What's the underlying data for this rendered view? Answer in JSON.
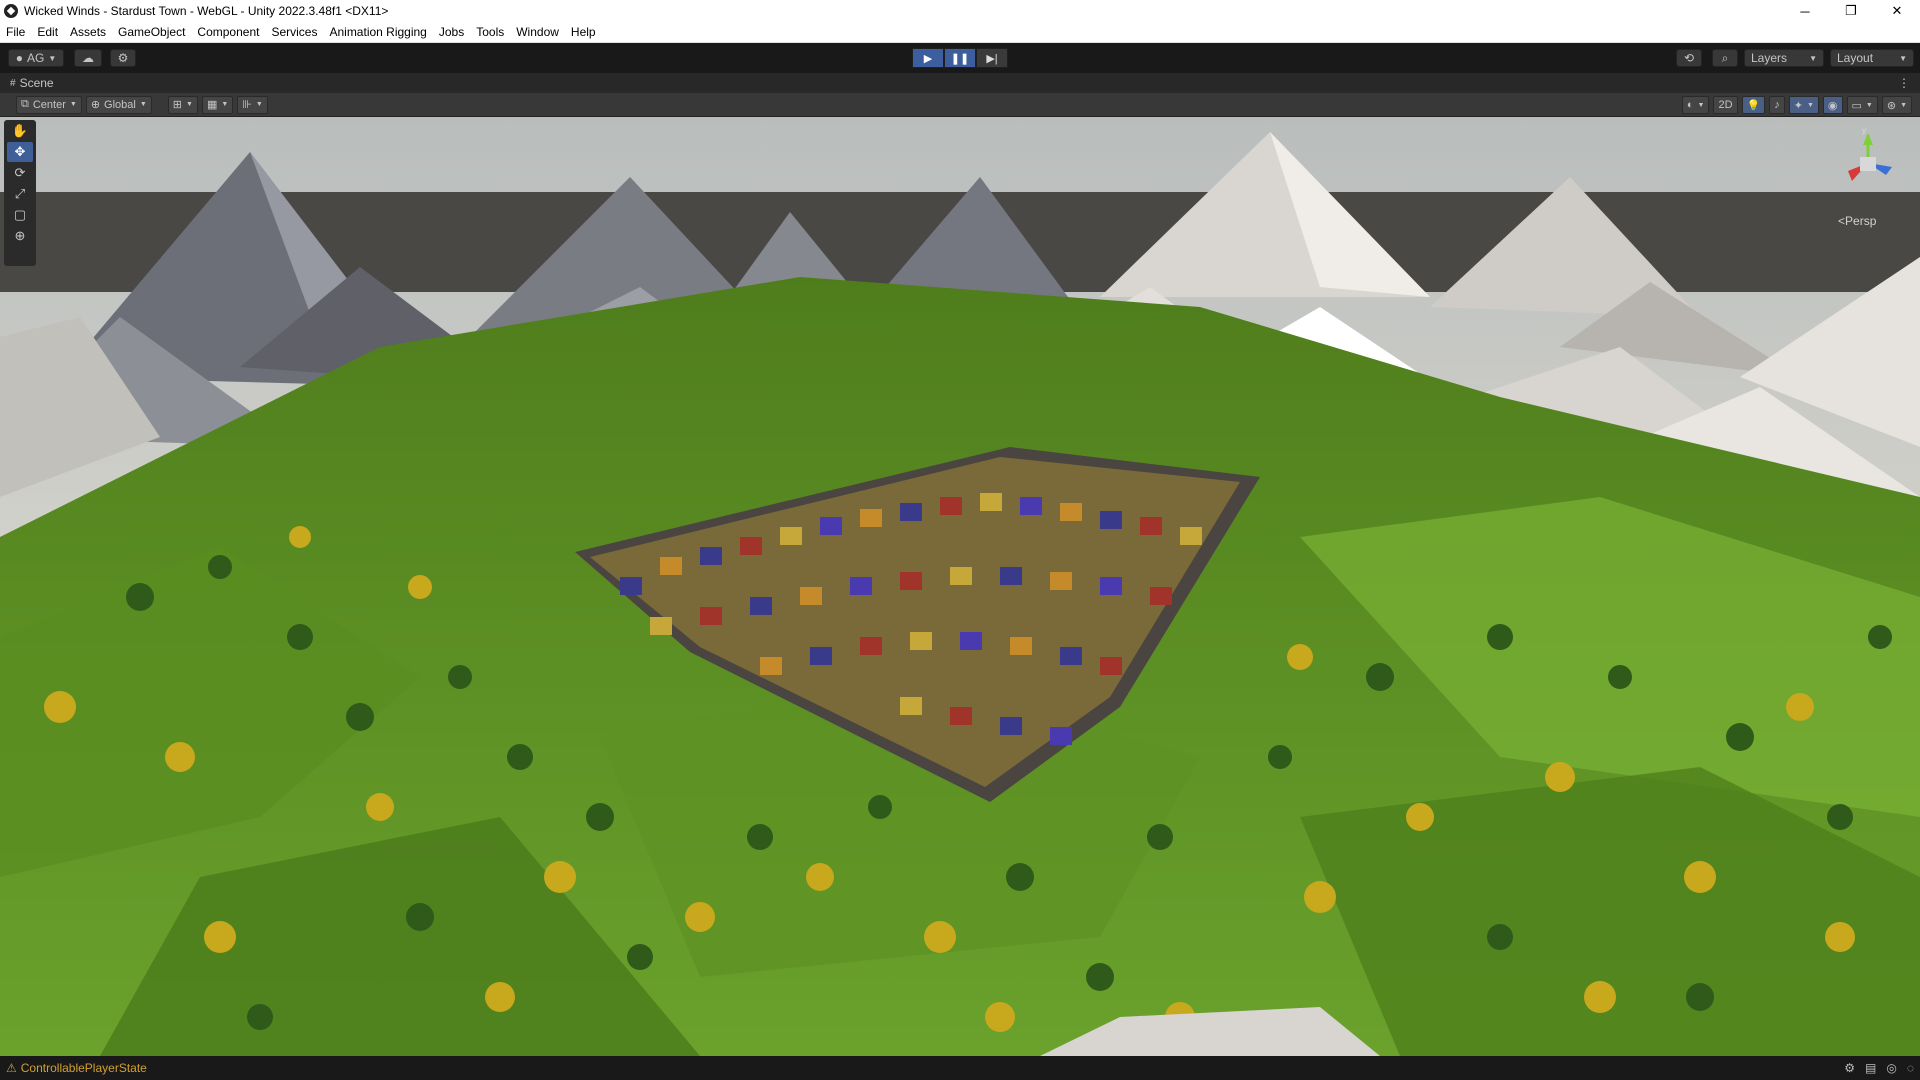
{
  "window": {
    "title": "Wicked Winds - Stardust Town - WebGL - Unity 2022.3.48f1 <DX11>",
    "controls": {
      "minimize": "─",
      "maximize": "❐",
      "close": "✕"
    }
  },
  "menu": [
    "File",
    "Edit",
    "Assets",
    "GameObject",
    "Component",
    "Services",
    "Animation Rigging",
    "Jobs",
    "Tools",
    "Window",
    "Help"
  ],
  "toolbar": {
    "account_label": "AG",
    "layers_label": "Layers",
    "layout_label": "Layout"
  },
  "tab": {
    "label": "Scene"
  },
  "scene_toolbar": {
    "pivot_label": "Center",
    "space_label": "Global",
    "twod_label": "2D"
  },
  "viewport": {
    "persp_label": "Persp",
    "colors": {
      "sky": "#c9ccc9",
      "grass": "#6fa52a",
      "mountain": "#8a8c95",
      "snow": "#e5e3e0"
    }
  },
  "status": {
    "message": "ControllablePlayerState"
  }
}
